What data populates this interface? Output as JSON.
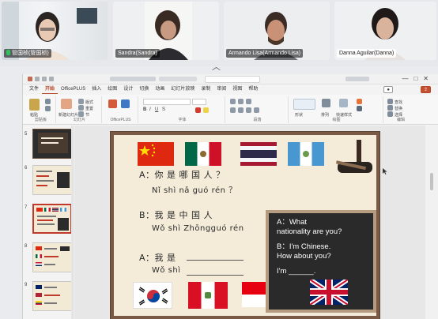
{
  "participants": [
    {
      "name": "管国桢(管国桢)",
      "mic": true
    },
    {
      "name": "Sandra(Sandra)",
      "mic": false
    },
    {
      "name": "Armando Lisa(Armando Lisa)",
      "mic": false
    },
    {
      "name": "Danna Aguilar(Danna)",
      "mic": false
    }
  ],
  "strip_toggle": "︿",
  "menu_tabs": [
    "文件",
    "开始",
    "OfficePLUS",
    "插入",
    "绘图",
    "设计",
    "切换",
    "动画",
    "幻灯片放映",
    "录制",
    "审阅",
    "视图",
    "帮助"
  ],
  "active_tab": "开始",
  "ribbon": {
    "groups": [
      "剪贴板",
      "幻灯片",
      "OfficePLUS",
      "字体",
      "段落",
      "绘图",
      "编辑"
    ],
    "buttons": [
      "粘贴",
      "新建幻灯片",
      "版式",
      "重置",
      "节",
      "形状",
      "排列",
      "快速样式",
      "查找",
      "替换",
      "选择"
    ]
  },
  "thumbnails": [
    {
      "number": "5"
    },
    {
      "number": "6"
    },
    {
      "number": "7",
      "selected": true
    },
    {
      "number": "8"
    },
    {
      "number": "9"
    }
  ],
  "slide": {
    "line1_ch": "A：你 是  哪 国  人 ？",
    "line1_py": "Nǐ shì nǎ guó rén ？",
    "line2_ch": "B：我 是    中 国    人",
    "line2_py": "Wǒ shì Zhōngguó rén",
    "line3_ch": "A：我 是",
    "line3_py": "Wǒ shì",
    "callout": [
      "A：What",
      "nationality are you?",
      "B：I'm Chinese.",
      "How about you?",
      "I'm ______."
    ],
    "top_flags": [
      "China",
      "Mexico",
      "Thailand",
      "Guatemala"
    ],
    "bottom_flags": [
      "South Korea",
      "Peru",
      "Indonesia",
      "United Kingdom"
    ]
  },
  "colors": {
    "accent": "#b7472a",
    "slide_bg": "#f4ecd9",
    "frame": "#7a5a44",
    "callout_bg": "#2a2a2a"
  }
}
